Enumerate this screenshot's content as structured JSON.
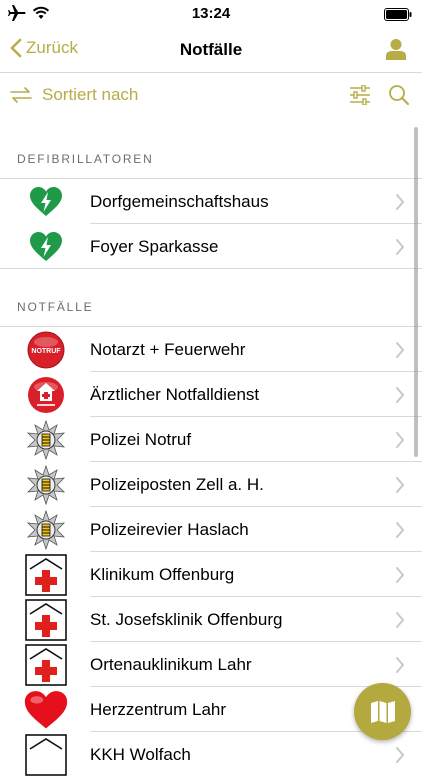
{
  "status_bar": {
    "time": "13:24"
  },
  "nav": {
    "back_label": "Zurück",
    "title": "Notfälle"
  },
  "toolbar": {
    "sort_label": "Sortiert nach"
  },
  "colors": {
    "accent": "#b7ac45",
    "defibrillator_green": "#1f9a48",
    "notruf_red": "#d9202a",
    "hospital_red": "#e0201d",
    "heart_red": "#e5101b"
  },
  "sections": [
    {
      "header": "DEFIBRILLATOREN",
      "items": [
        {
          "label": "Dorfgemeinschaftshaus",
          "icon": "defibrillator-heart-icon"
        },
        {
          "label": "Foyer Sparkasse",
          "icon": "defibrillator-heart-icon"
        }
      ]
    },
    {
      "header": "NOTFÄLLE",
      "items": [
        {
          "label": "Notarzt + Feuerwehr",
          "icon": "notruf-icon",
          "icon_text": "NOTRUF"
        },
        {
          "label": "Ärztlicher Notfalldienst",
          "icon": "notdienst-house-icon"
        },
        {
          "label": "Polizei Notruf",
          "icon": "police-star-icon"
        },
        {
          "label": "Polizeiposten Zell a. H.",
          "icon": "police-star-icon"
        },
        {
          "label": "Polizeirevier Haslach",
          "icon": "police-star-icon"
        },
        {
          "label": "Klinikum Offenburg",
          "icon": "hospital-cross-icon"
        },
        {
          "label": "St. Josefsklinik Offenburg",
          "icon": "hospital-cross-icon"
        },
        {
          "label": "Ortenauklinikum Lahr",
          "icon": "hospital-cross-icon"
        },
        {
          "label": "Herzzentrum Lahr",
          "icon": "heart-icon"
        },
        {
          "label": "KKH Wolfach",
          "icon": "hospital-cross-icon"
        }
      ]
    }
  ]
}
